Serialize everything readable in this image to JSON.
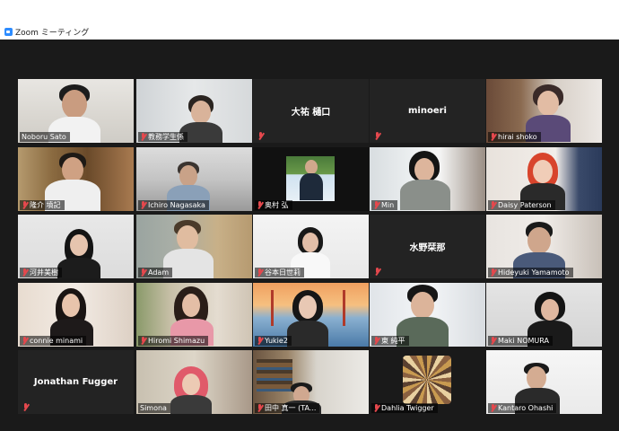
{
  "window": {
    "title": "Zoom ミーティング"
  },
  "participants": [
    {
      "name": "Noboru Sato",
      "muted": false,
      "video": true,
      "active": true
    },
    {
      "name": "教務学生係",
      "muted": true,
      "video": true
    },
    {
      "name": "大祐 樋口",
      "muted": true,
      "video": false
    },
    {
      "name": "minoeri",
      "muted": true,
      "video": false
    },
    {
      "name": "hirai shoko",
      "muted": true,
      "video": true
    },
    {
      "name": "隆介 墳記",
      "muted": true,
      "video": true
    },
    {
      "name": "Ichiro Nagasaka",
      "muted": true,
      "video": true
    },
    {
      "name": "奥村 弘",
      "muted": true,
      "video": true
    },
    {
      "name": "Min",
      "muted": true,
      "video": true
    },
    {
      "name": "Daisy Paterson",
      "muted": true,
      "video": true
    },
    {
      "name": "河井美樹",
      "muted": true,
      "video": true
    },
    {
      "name": "Adam",
      "muted": true,
      "video": true
    },
    {
      "name": "谷本日世莉",
      "muted": true,
      "video": true
    },
    {
      "name": "水野栞那",
      "muted": true,
      "video": false
    },
    {
      "name": "Hideyuki Yamamoto",
      "muted": true,
      "video": true
    },
    {
      "name": "connie minami",
      "muted": true,
      "video": true
    },
    {
      "name": "Hiromi Shimazu",
      "muted": true,
      "video": true
    },
    {
      "name": "Yukie2",
      "muted": true,
      "video": true
    },
    {
      "name": "東 純平",
      "muted": true,
      "video": true
    },
    {
      "name": "Maki NOMURA",
      "muted": true,
      "video": true
    },
    {
      "name": "Jonathan Fugger",
      "muted": true,
      "video": false
    },
    {
      "name": "Simona",
      "muted": false,
      "video": true
    },
    {
      "name": "田中 真一 (TA...",
      "muted": true,
      "video": true
    },
    {
      "name": "Dahlia Twigger",
      "muted": true,
      "video": true
    },
    {
      "name": "Kantaro Ohashi",
      "muted": true,
      "video": true
    }
  ],
  "colors": {
    "active_border": "#d7e35a",
    "mute": "#e5484d",
    "background": "#1a1a1a"
  }
}
